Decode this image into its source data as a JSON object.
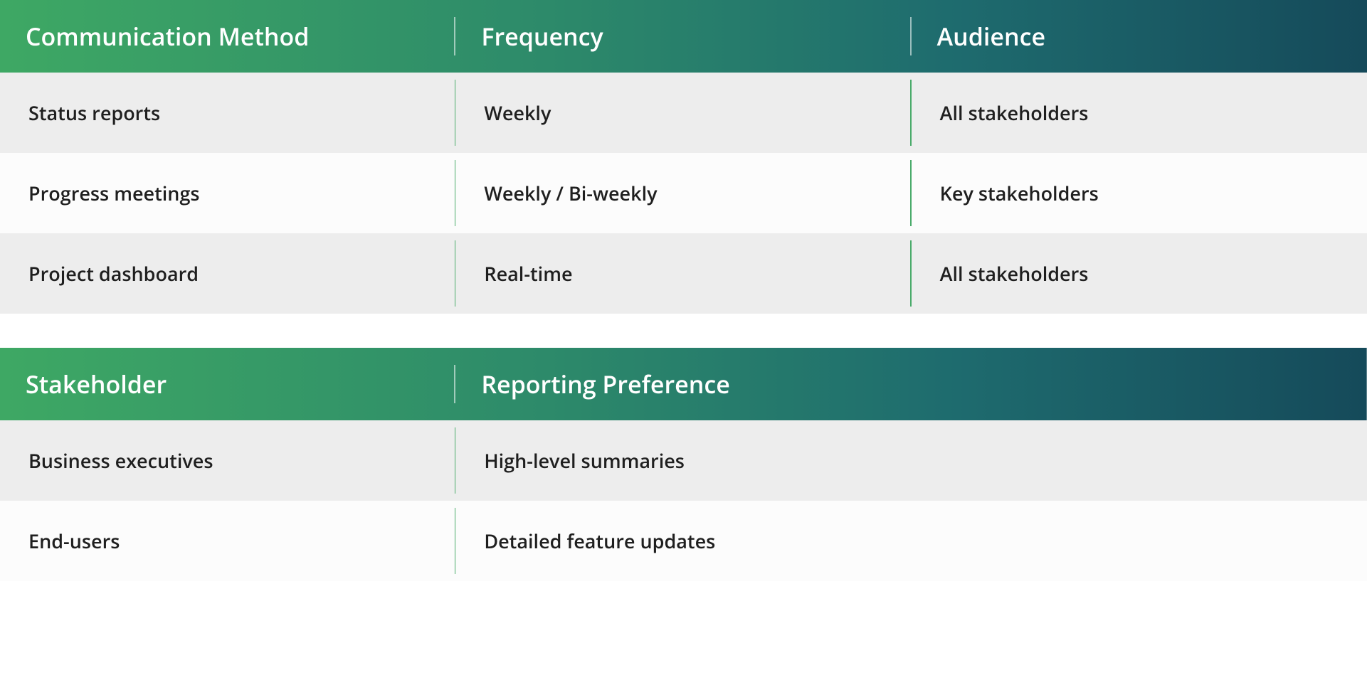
{
  "table1": {
    "headers": [
      "Communication Method",
      "Frequency",
      "Audience"
    ],
    "rows": [
      [
        "Status reports",
        "Weekly",
        "All stakeholders"
      ],
      [
        "Progress meetings",
        "Weekly / Bi-weekly",
        "Key stakeholders"
      ],
      [
        "Project dashboard",
        "Real-time",
        "All stakeholders"
      ]
    ]
  },
  "table2": {
    "headers": [
      "Stakeholder",
      "Reporting Preference"
    ],
    "rows": [
      [
        "Business executives",
        "High-level summaries"
      ],
      [
        "End-users",
        "Detailed feature updates"
      ]
    ]
  }
}
